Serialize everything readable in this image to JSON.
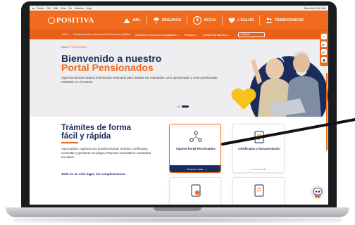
{
  "menubar": {
    "items": [
      "Finder",
      "File",
      "Edit",
      "View",
      "Go",
      "Window",
      "Help"
    ],
    "clock": "Mon Jun 5 9:41 AM"
  },
  "header": {
    "logo": "POSITIVA",
    "pills": [
      {
        "label": "ARL",
        "icon": "arl-icon"
      },
      {
        "label": "SEGUROS",
        "icon": "umbrella-icon"
      },
      {
        "label": "ACCAI",
        "icon": "accai-icon"
      },
      {
        "label": "+ SALUD",
        "icon": "heart-icon"
      },
      {
        "label": "PENSIONADOS",
        "icon": "people-icon"
      }
    ]
  },
  "nav": {
    "items": [
      "Inicio",
      "Transparencia y acceso a la información pública",
      "Atención y servicio a la ciudadanía",
      "Participa",
      "Canales de atención"
    ],
    "search_placeholder": "Buscar"
  },
  "a11y": [
    "◐",
    "A⁻",
    "A⁺",
    "▣"
  ],
  "hero": {
    "breadcrumb_home": "Inicio",
    "breadcrumb_sep": " › ",
    "breadcrumb_current": "Pensionados",
    "title_line1": "Bienvenido a nuestro",
    "title_line2": "Portal Pensionados",
    "text": "Aquí encontrarás toda la información necesaria para realizar tus solicitudes como pensionado y como pensionado residente en el exterior."
  },
  "lower": {
    "title_line1": "Trámites de forma",
    "title_line2": "fácil y rápida",
    "text": "Aquí podrás: Ingresar a tu portal personal, Solicitar certificados, Consultar y gestionar tus pagos, Reportar novedades o actualizar tus datos.",
    "bold": "Todo en un solo lugar, sin complicaciones."
  },
  "cards": [
    {
      "label": "Ingreso Portal Pensionados",
      "cta": "Conoce más"
    },
    {
      "label": "Certificados y documentación",
      "cta": "Conoce más"
    }
  ],
  "colors": {
    "brand_orange": "#f26a1b",
    "navy": "#1a2b5e"
  }
}
